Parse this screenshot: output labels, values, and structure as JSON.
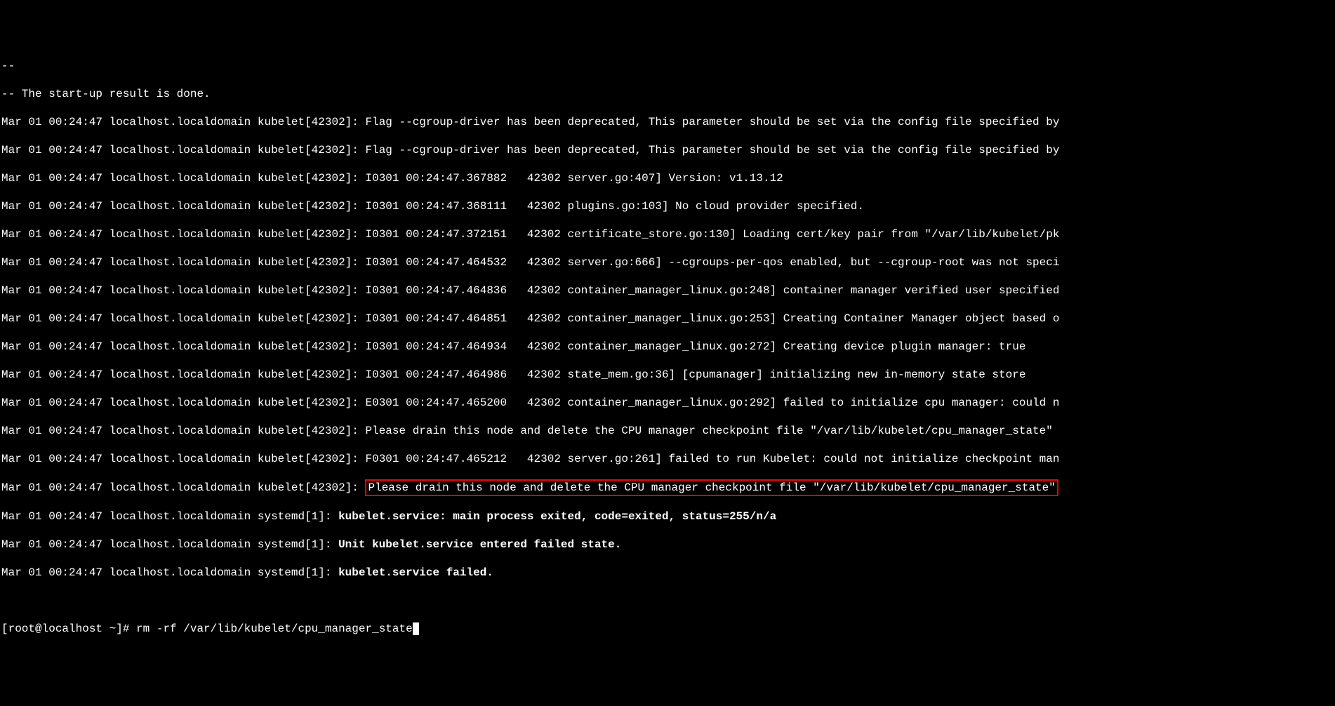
{
  "terminal": {
    "dash_line": "--",
    "startup_msg": "-- The start-up result is done.",
    "lines": [
      "Mar 01 00:24:47 localhost.localdomain kubelet[42302]: Flag --cgroup-driver has been deprecated, This parameter should be set via the config file specified by",
      "Mar 01 00:24:47 localhost.localdomain kubelet[42302]: Flag --cgroup-driver has been deprecated, This parameter should be set via the config file specified by",
      "Mar 01 00:24:47 localhost.localdomain kubelet[42302]: I0301 00:24:47.367882   42302 server.go:407] Version: v1.13.12",
      "Mar 01 00:24:47 localhost.localdomain kubelet[42302]: I0301 00:24:47.368111   42302 plugins.go:103] No cloud provider specified.",
      "Mar 01 00:24:47 localhost.localdomain kubelet[42302]: I0301 00:24:47.372151   42302 certificate_store.go:130] Loading cert/key pair from \"/var/lib/kubelet/pk",
      "Mar 01 00:24:47 localhost.localdomain kubelet[42302]: I0301 00:24:47.464532   42302 server.go:666] --cgroups-per-qos enabled, but --cgroup-root was not speci",
      "Mar 01 00:24:47 localhost.localdomain kubelet[42302]: I0301 00:24:47.464836   42302 container_manager_linux.go:248] container manager verified user specified",
      "Mar 01 00:24:47 localhost.localdomain kubelet[42302]: I0301 00:24:47.464851   42302 container_manager_linux.go:253] Creating Container Manager object based o",
      "Mar 01 00:24:47 localhost.localdomain kubelet[42302]: I0301 00:24:47.464934   42302 container_manager_linux.go:272] Creating device plugin manager: true",
      "Mar 01 00:24:47 localhost.localdomain kubelet[42302]: I0301 00:24:47.464986   42302 state_mem.go:36] [cpumanager] initializing new in-memory state store",
      "Mar 01 00:24:47 localhost.localdomain kubelet[42302]: E0301 00:24:47.465200   42302 container_manager_linux.go:292] failed to initialize cpu manager: could n",
      "Mar 01 00:24:47 localhost.localdomain kubelet[42302]: Please drain this node and delete the CPU manager checkpoint file \"/var/lib/kubelet/cpu_manager_state\"",
      "Mar 01 00:24:47 localhost.localdomain kubelet[42302]: F0301 00:24:47.465212   42302 server.go:261] failed to run Kubelet: could not initialize checkpoint man"
    ],
    "highlighted_line_prefix": "Mar 01 00:24:47 localhost.localdomain kubelet[42302]: ",
    "highlighted_text": "Please drain this node and delete the CPU manager checkpoint file \"/var/lib/kubelet/cpu_manager_state\"",
    "systemd_line1_prefix": "Mar 01 00:24:47 localhost.localdomain systemd[1]: ",
    "systemd_line1_bold": "kubelet.service: main process exited, code=exited, status=255/n/a",
    "systemd_line2_prefix": "Mar 01 00:24:47 localhost.localdomain systemd[1]: ",
    "systemd_line2_bold": "Unit kubelet.service entered failed state.",
    "systemd_line3_prefix": "Mar 01 00:24:47 localhost.localdomain systemd[1]: ",
    "systemd_line3_bold": "kubelet.service failed.",
    "prompt": "[root@localhost ~]# ",
    "command": "rm -rf /var/lib/kubelet/cpu_manager_state"
  }
}
